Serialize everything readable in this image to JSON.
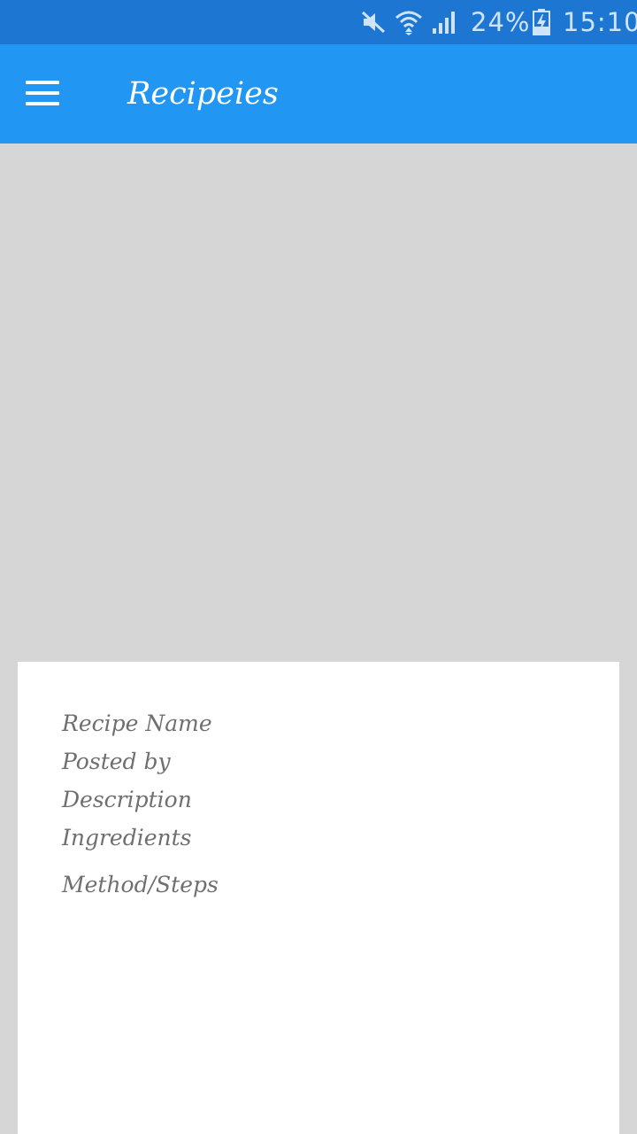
{
  "status_bar": {
    "battery_percent": "24%",
    "time": "15:10",
    "icons": [
      "mute-icon",
      "wifi-icon",
      "signal-icon",
      "battery-charging-icon"
    ]
  },
  "app_bar": {
    "title": "Recipeies",
    "menu_icon": "hamburger-menu-icon"
  },
  "recipe": {
    "name_label": "Recipe Name",
    "posted_by_label": "Posted by",
    "description_label": "Description",
    "ingredients_label": "Ingredients",
    "method_label": "Method/Steps"
  },
  "colors": {
    "status_bar": "#1c76d2",
    "app_bar": "#2196f3",
    "background": "#d6d6d6",
    "card": "#ffffff",
    "label_text": "#6f6f6f"
  }
}
